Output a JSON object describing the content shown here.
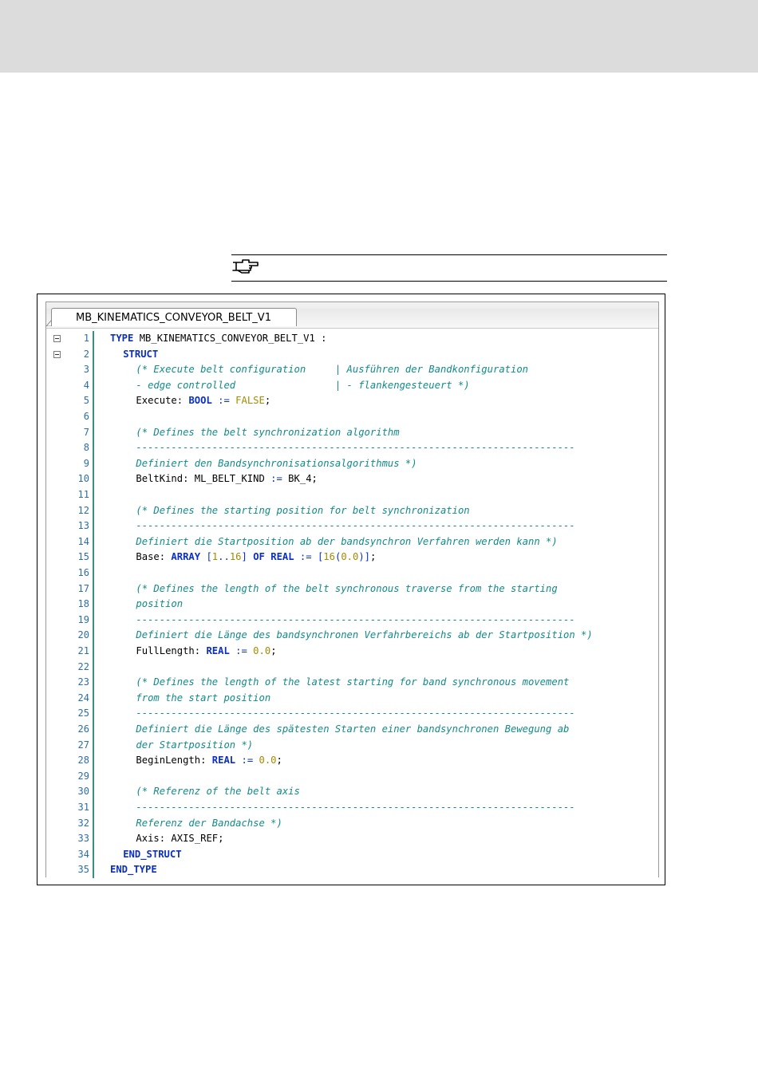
{
  "editor": {
    "tab_title": "MB_KINEMATICS_CONVEYOR_BELT_V1"
  },
  "colors": {
    "keyword": "#0a2fc2",
    "comment": "#128a8a",
    "number": "#a58a00",
    "line_number": "#2b6fa5",
    "gutter_line": "#3a8f7a"
  },
  "icons": {
    "note": "pointing-hand-icon",
    "fold": "collapse-minus-icon"
  },
  "code": {
    "lines": [
      {
        "n": "1",
        "indent": 0,
        "fold": true,
        "tokens": [
          {
            "t": "TYPE",
            "c": "kw"
          },
          {
            "t": " MB_KINEMATICS_CONVEYOR_BELT_V1 :",
            "c": "id"
          }
        ]
      },
      {
        "n": "2",
        "indent": 2,
        "fold": true,
        "tokens": [
          {
            "t": "STRUCT",
            "c": "kw"
          }
        ]
      },
      {
        "n": "3",
        "indent": 4,
        "tokens": [
          {
            "t": "(* Execute belt configuration     | Ausführen der Bandkonfiguration",
            "c": "cm"
          }
        ]
      },
      {
        "n": "4",
        "indent": 4,
        "tokens": [
          {
            "t": "- edge controlled                 | - flankengesteuert *)",
            "c": "cm"
          }
        ]
      },
      {
        "n": "5",
        "indent": 4,
        "tokens": [
          {
            "t": "Execute: ",
            "c": "id"
          },
          {
            "t": "BOOL",
            "c": "kw"
          },
          {
            "t": " := ",
            "c": "op"
          },
          {
            "t": "FALSE",
            "c": "num"
          },
          {
            "t": ";",
            "c": "id"
          }
        ]
      },
      {
        "n": "6",
        "indent": 0,
        "tokens": []
      },
      {
        "n": "7",
        "indent": 4,
        "tokens": [
          {
            "t": "(* Defines the belt synchronization algorithm",
            "c": "cm"
          }
        ]
      },
      {
        "n": "8",
        "indent": 4,
        "tokens": [
          {
            "t": "---------------------------------------------------------------------------",
            "c": "cm"
          }
        ]
      },
      {
        "n": "9",
        "indent": 4,
        "tokens": [
          {
            "t": "Definiert den Bandsynchronisationsalgorithmus *)",
            "c": "cm"
          }
        ]
      },
      {
        "n": "10",
        "indent": 4,
        "tokens": [
          {
            "t": "BeltKind: ML_BELT_KIND ",
            "c": "id"
          },
          {
            "t": ":=",
            "c": "op"
          },
          {
            "t": " BK_4;",
            "c": "id"
          }
        ]
      },
      {
        "n": "11",
        "indent": 0,
        "tokens": []
      },
      {
        "n": "12",
        "indent": 4,
        "tokens": [
          {
            "t": "(* Defines the starting position for belt synchronization",
            "c": "cm"
          }
        ]
      },
      {
        "n": "13",
        "indent": 4,
        "tokens": [
          {
            "t": "---------------------------------------------------------------------------",
            "c": "cm"
          }
        ]
      },
      {
        "n": "14",
        "indent": 4,
        "tokens": [
          {
            "t": "Definiert die Startposition ab der bandsynchron Verfahren werden kann *)",
            "c": "cm"
          }
        ]
      },
      {
        "n": "15",
        "indent": 4,
        "tokens": [
          {
            "t": "Base: ",
            "c": "id"
          },
          {
            "t": "ARRAY",
            "c": "kw"
          },
          {
            "t": " [",
            "c": "op"
          },
          {
            "t": "1",
            "c": "num"
          },
          {
            "t": "..",
            "c": "op"
          },
          {
            "t": "16",
            "c": "num"
          },
          {
            "t": "] ",
            "c": "op"
          },
          {
            "t": "OF",
            "c": "kw"
          },
          {
            "t": " ",
            "c": "id"
          },
          {
            "t": "REAL",
            "c": "kw"
          },
          {
            "t": " := [",
            "c": "op"
          },
          {
            "t": "16",
            "c": "num"
          },
          {
            "t": "(",
            "c": "op"
          },
          {
            "t": "0.0",
            "c": "num"
          },
          {
            "t": ")]",
            "c": "op"
          },
          {
            "t": ";",
            "c": "id"
          }
        ]
      },
      {
        "n": "16",
        "indent": 0,
        "tokens": []
      },
      {
        "n": "17",
        "indent": 4,
        "tokens": [
          {
            "t": "(* Defines the length of the belt synchronous traverse from the starting",
            "c": "cm"
          }
        ]
      },
      {
        "n": "18",
        "indent": 4,
        "tokens": [
          {
            "t": "position",
            "c": "cm"
          }
        ]
      },
      {
        "n": "19",
        "indent": 4,
        "tokens": [
          {
            "t": "---------------------------------------------------------------------------",
            "c": "cm"
          }
        ]
      },
      {
        "n": "20",
        "indent": 4,
        "tokens": [
          {
            "t": "Definiert die Länge des bandsynchronen Verfahrbereichs ab der Startposition *)",
            "c": "cm"
          }
        ]
      },
      {
        "n": "21",
        "indent": 4,
        "tokens": [
          {
            "t": "FullLength: ",
            "c": "id"
          },
          {
            "t": "REAL",
            "c": "kw"
          },
          {
            "t": " := ",
            "c": "op"
          },
          {
            "t": "0.0",
            "c": "num"
          },
          {
            "t": ";",
            "c": "id"
          }
        ]
      },
      {
        "n": "22",
        "indent": 0,
        "tokens": []
      },
      {
        "n": "23",
        "indent": 4,
        "tokens": [
          {
            "t": "(* Defines the length of the latest starting for band synchronous movement",
            "c": "cm"
          }
        ]
      },
      {
        "n": "24",
        "indent": 4,
        "tokens": [
          {
            "t": "from the start position",
            "c": "cm"
          }
        ]
      },
      {
        "n": "25",
        "indent": 4,
        "tokens": [
          {
            "t": "---------------------------------------------------------------------------",
            "c": "cm"
          }
        ]
      },
      {
        "n": "26",
        "indent": 4,
        "tokens": [
          {
            "t": "Definiert die Länge des spätesten Starten einer bandsynchronen Bewegung ab",
            "c": "cm"
          }
        ]
      },
      {
        "n": "27",
        "indent": 4,
        "tokens": [
          {
            "t": "der Startposition *)",
            "c": "cm"
          }
        ]
      },
      {
        "n": "28",
        "indent": 4,
        "tokens": [
          {
            "t": "BeginLength: ",
            "c": "id"
          },
          {
            "t": "REAL",
            "c": "kw"
          },
          {
            "t": " := ",
            "c": "op"
          },
          {
            "t": "0.0",
            "c": "num"
          },
          {
            "t": ";",
            "c": "id"
          }
        ]
      },
      {
        "n": "29",
        "indent": 0,
        "tokens": []
      },
      {
        "n": "30",
        "indent": 4,
        "tokens": [
          {
            "t": "(* Referenz of the belt axis",
            "c": "cm"
          }
        ]
      },
      {
        "n": "31",
        "indent": 4,
        "tokens": [
          {
            "t": "---------------------------------------------------------------------------",
            "c": "cm"
          }
        ]
      },
      {
        "n": "32",
        "indent": 4,
        "tokens": [
          {
            "t": "Referenz der Bandachse *)",
            "c": "cm"
          }
        ]
      },
      {
        "n": "33",
        "indent": 4,
        "tokens": [
          {
            "t": "Axis: AXIS_REF;",
            "c": "id"
          }
        ]
      },
      {
        "n": "34",
        "indent": 2,
        "tokens": [
          {
            "t": "END_STRUCT",
            "c": "kw"
          }
        ]
      },
      {
        "n": "35",
        "indent": 0,
        "tokens": [
          {
            "t": "END_TYPE",
            "c": "kw"
          }
        ]
      }
    ]
  }
}
